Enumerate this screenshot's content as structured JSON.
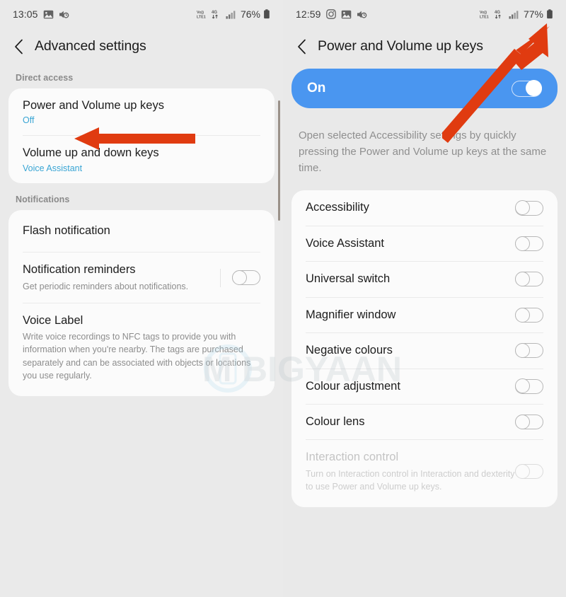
{
  "accent": {
    "blue": "#4a96f0",
    "link_blue": "#39a5d4",
    "arrow_red": "#e03b10"
  },
  "left_screen": {
    "status_bar": {
      "time": "13:05",
      "icons": [
        "image-icon",
        "sound-off-icon"
      ],
      "network_volte": "VoLTE",
      "network_type": "4G",
      "battery_percent": "76%"
    },
    "app_bar": {
      "back_icon": "back-chevron-icon",
      "title": "Advanced settings"
    },
    "sections": [
      {
        "label": "Direct access",
        "rows": [
          {
            "title": "Power and Volume up keys",
            "sub": "Off",
            "toggle": null
          },
          {
            "title": "Volume up and down keys",
            "sub": "Voice Assistant",
            "toggle": null
          }
        ]
      },
      {
        "label": "Notifications",
        "rows": [
          {
            "title": "Flash notification",
            "sub": null,
            "toggle": null
          },
          {
            "title": "Notification reminders",
            "desc": "Get periodic reminders about notifications.",
            "toggle": "off"
          },
          {
            "title": "Voice Label",
            "desc": "Write voice recordings to NFC tags to provide you with information when you're nearby. The tags are purchased separately and can be associated with objects or locations you use regularly.",
            "toggle": null
          }
        ]
      }
    ]
  },
  "right_screen": {
    "status_bar": {
      "time": "12:59",
      "icons": [
        "camera-icon",
        "image-icon",
        "sound-off-icon"
      ],
      "network_volte": "VoLTE",
      "network_type": "4G",
      "battery_percent": "77%"
    },
    "app_bar": {
      "back_icon": "back-chevron-icon",
      "title": "Power and Volume up keys"
    },
    "master_switch": {
      "label": "On",
      "state": "on"
    },
    "description": "Open selected Accessibility settings by quickly pressing the Power and Volume up keys at the same time.",
    "options": [
      {
        "title": "Accessibility",
        "toggle": "off",
        "disabled": false
      },
      {
        "title": "Voice Assistant",
        "toggle": "off",
        "disabled": false
      },
      {
        "title": "Universal switch",
        "toggle": "off",
        "disabled": false
      },
      {
        "title": "Magnifier window",
        "toggle": "off",
        "disabled": false
      },
      {
        "title": "Negative colours",
        "toggle": "off",
        "disabled": false
      },
      {
        "title": "Colour adjustment",
        "toggle": "off",
        "disabled": false
      },
      {
        "title": "Colour lens",
        "toggle": "off",
        "disabled": false
      },
      {
        "title": "Interaction control",
        "desc": "Turn on Interaction control in Interaction and dexterity to use Power and Volume up keys.",
        "toggle": "off",
        "disabled": true
      }
    ]
  },
  "annotations": {
    "left_arrow": "red-arrow-pointing-left",
    "right_arrow": "red-arrow-pointing-up-right"
  },
  "watermark": {
    "text": "MOBIGYAAN"
  }
}
